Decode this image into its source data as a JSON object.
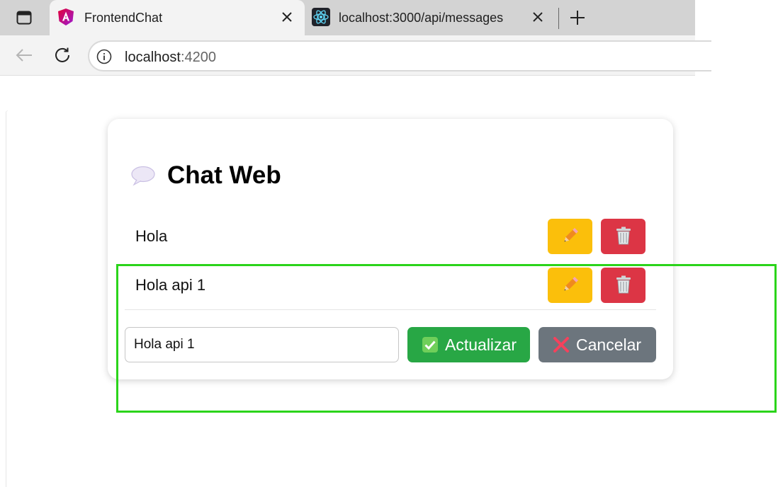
{
  "browser": {
    "tabs": [
      {
        "title": "FrontendChat",
        "active": true,
        "icon": "angular-icon"
      },
      {
        "title": "localhost:3000/api/messages",
        "active": false,
        "icon": "react-icon"
      }
    ],
    "url_host": "localhost",
    "url_port": ":4200"
  },
  "chat": {
    "title": "Chat Web",
    "title_icon": "speech-bubble-icon",
    "messages": [
      {
        "text": "Hola"
      },
      {
        "text": "Hola api 1"
      }
    ],
    "edit": {
      "value": "Hola api 1",
      "update_label": "Actualizar",
      "cancel_label": "Cancelar"
    }
  },
  "colors": {
    "edit_button": "#fbbf0b",
    "delete_button": "#dc3545",
    "update_button": "#28a745",
    "cancel_button": "#6c757d",
    "highlight_box": "#2bd41a"
  }
}
